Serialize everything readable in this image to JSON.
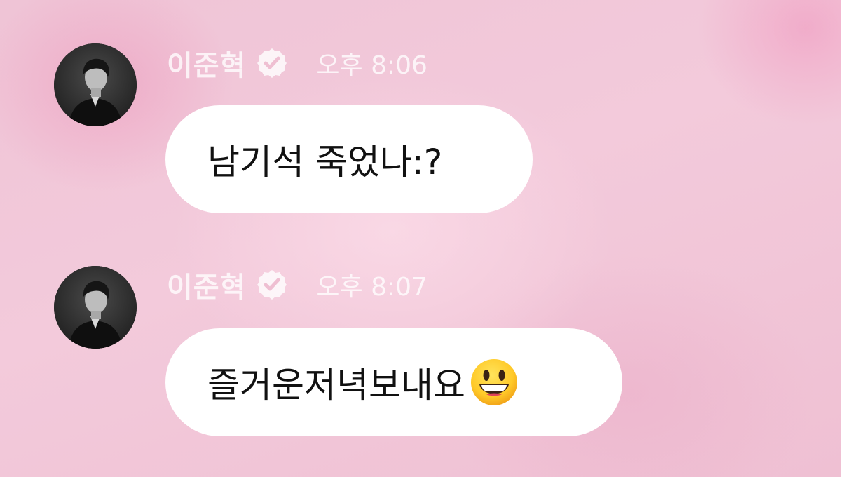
{
  "messages": [
    {
      "sender": "이준혁",
      "time": "오후 8:06",
      "text": "남기석 죽었나:?",
      "icons": {
        "verified": "verified-badge-icon",
        "avatar": "profile-avatar"
      }
    },
    {
      "sender": "이준혁",
      "time": "오후 8:07",
      "text": "즐거운저녁보내요",
      "emoji": "grinning-face-icon",
      "icons": {
        "verified": "verified-badge-icon",
        "avatar": "profile-avatar"
      }
    }
  ],
  "colors": {
    "background": "#f1c3d6",
    "bubble": "#ffffff",
    "header_text": "#ffffff",
    "message_text": "#111111"
  }
}
